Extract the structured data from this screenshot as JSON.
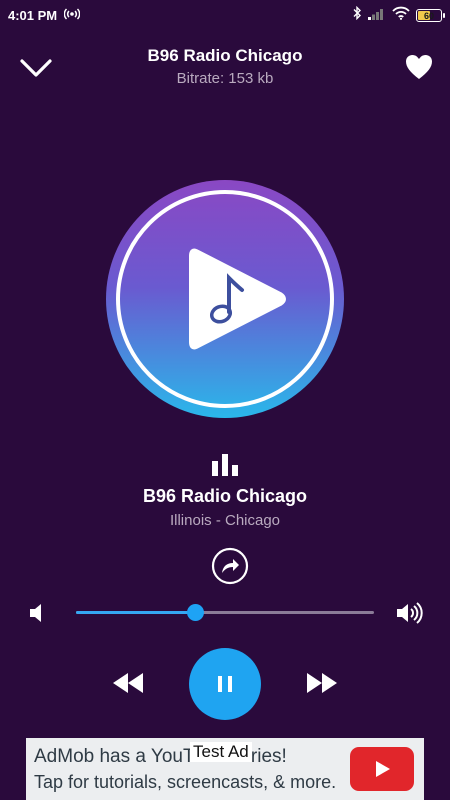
{
  "status_bar": {
    "time": "4:01 PM",
    "battery_level": "60",
    "battery_fill": 0.6
  },
  "header": {
    "title": "B96 Radio Chicago",
    "bitrate": "Bitrate: 153 kb"
  },
  "now_playing": {
    "title": "B96 Radio Chicago",
    "subtitle": "Illinois - Chicago"
  },
  "volume": {
    "level": 0.4
  },
  "ad": {
    "label": "Test Ad",
    "line1": "AdMob has a YouTube series!",
    "line2": "Tap for tutorials, screencasts, & more."
  },
  "colors": {
    "background": "#2a0a3c",
    "accent": "#1fa4f1",
    "artwork_gradient_top": "#8a48c4",
    "artwork_gradient_bottom": "#2ab7ea",
    "ad_button": "#e1262b"
  },
  "icons": {
    "collapse": "chevron-down-icon",
    "favorite": "heart-icon",
    "artwork": "music-note-play-icon",
    "equalizer": "equalizer-icon",
    "share": "share-icon",
    "volume_low": "volume-low-icon",
    "volume_high": "volume-high-icon",
    "rewind": "rewind-icon",
    "pause": "pause-icon",
    "forward": "fast-forward-icon",
    "ad_button": "youtube-play-icon"
  }
}
